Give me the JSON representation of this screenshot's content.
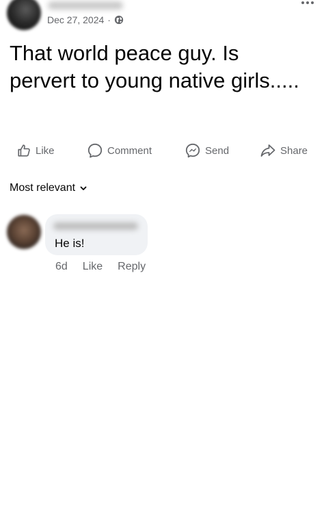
{
  "post": {
    "date": "Dec 27, 2024",
    "separator": "·",
    "audience_icon": "globe-icon",
    "more_icon": "more-options-icon",
    "text": "That world peace guy. Is pervert to young native girls....."
  },
  "actions": {
    "like": "Like",
    "comment": "Comment",
    "send": "Send",
    "share": "Share"
  },
  "comments_sort": {
    "label": "Most relevant"
  },
  "comments": [
    {
      "text": "He is!",
      "age": "6d",
      "like_label": "Like",
      "reply_label": "Reply"
    }
  ],
  "colors": {
    "secondary_text": "#65676b",
    "primary_text": "#050505",
    "comment_bubble": "#f0f2f5"
  }
}
